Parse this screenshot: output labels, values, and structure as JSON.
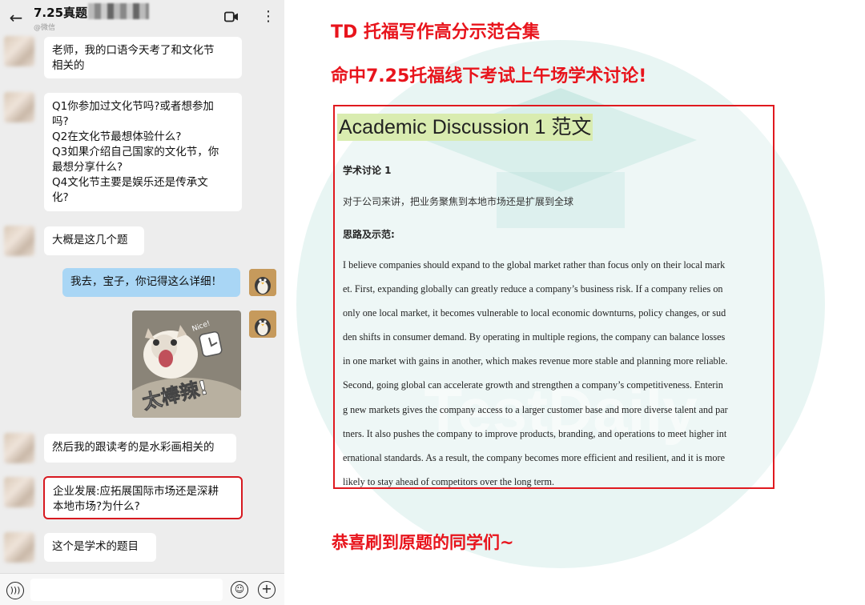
{
  "chat": {
    "title": "7.25真题",
    "subtitle": "@微信",
    "messages": [
      {
        "text": "老师，我的口语今天考了和文化节\n相关的"
      },
      {
        "text": "Q1你参加过文化节吗?或者想参加\n吗?\nQ2在文化节最想体验什么?\nQ3如果介绍自己国家的文化节，你\n最想分享什么?\nQ4文化节主要是娱乐还是传承文\n化?"
      },
      {
        "text": "大概是这几个题"
      },
      {
        "text": "我去，宝子，你记得这么详细！"
      },
      {
        "text": "然后我的跟读考的是水彩画相关的"
      },
      {
        "text": "企业发展:应拓展国际市场还是深耕\n本地市场?为什么?"
      },
      {
        "text": "这个是学术的题目"
      }
    ],
    "sticker_text": "太棒辣!",
    "sticker_tag": "Nice!",
    "icons": {
      "back": "arrow-left-icon",
      "video": "video-call-icon",
      "more": "more-vertical-icon",
      "voice": "voice-input-icon",
      "emoji": "emoji-icon",
      "plus": "add-icon"
    }
  },
  "right": {
    "heading1": "TD 托福写作高分示范合集",
    "heading2": "命中7.25托福线下考试上午场学术讨论!",
    "doc": {
      "title": "Academic Discussion 1 范文",
      "subtitle1": "学术讨论 1",
      "prompt": "对于公司来讲，把业务聚焦到本地市场还是扩展到全球",
      "subtitle2": "思路及示范:",
      "essay_lines": [
        "I believe companies should expand to the global market rather than focus only on their local mark",
        "et. First, expanding globally can greatly reduce a company’s business risk. If a company relies on",
        "only one local market, it becomes vulnerable to local economic downturns, policy changes, or sud",
        "den shifts in consumer demand. By operating in multiple regions, the company can balance losses",
        "in one market with gains in another, which makes revenue more stable and planning more reliable.",
        " Second, going global can accelerate growth and strengthen a company’s competitiveness. Enterin",
        "g new markets gives the company access to a larger customer base and more diverse talent and par",
        "tners. It also pushes the company to improve products, branding, and operations to meet higher int",
        "ernational standards. As a result, the company becomes more efficient and resilient, and it is more",
        "likely to stay ahead of competitors over the long term."
      ]
    },
    "watermark_text": "TestDaily",
    "congrats": "恭喜刷到原题的同学们~"
  },
  "colors": {
    "accent_red": "#e8141c",
    "chat_bg": "#ededed",
    "my_bubble": "#a9d6f5",
    "title_highlight": "#d9ecb0",
    "watermark": "#6fc3b6"
  }
}
